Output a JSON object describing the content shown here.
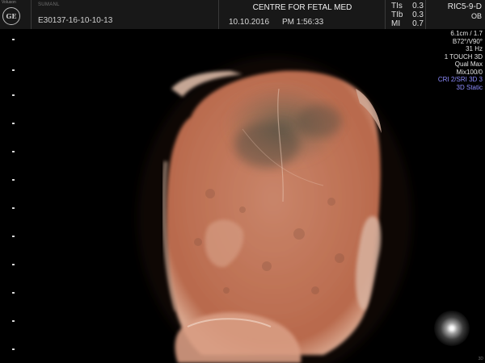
{
  "header": {
    "brand_small": "Voluson",
    "logo_text": "GE",
    "patient_name": "SUMANL",
    "patient_id": "E30137-16-10-10-13",
    "centre": "CENTRE FOR FETAL MED",
    "date": "10.10.2016",
    "time": "PM 1:56:33",
    "tis_label": "TIs",
    "tis_value": "0.3",
    "tib_label": "TIb",
    "tib_value": "0.3",
    "mi_label": "MI",
    "mi_value": "0.7",
    "probe": "RIC5-9-D",
    "preset": "OB"
  },
  "params": {
    "depth_freq": "6.1cm / 1.7",
    "angles": "B72°/V90°",
    "frame_rate": "31 Hz",
    "mode": "1 TOUCH 3D",
    "quality": "Qual Max",
    "mix": "Mix100/0",
    "cri": "CRI 2/SRI 3D 3",
    "render_mode": "3D Static"
  },
  "corner_label": "3D",
  "colors": {
    "background": "#000000",
    "header_bg": "#181818",
    "tissue": "#c8785a",
    "highlight_blue": "#8e8cff"
  }
}
